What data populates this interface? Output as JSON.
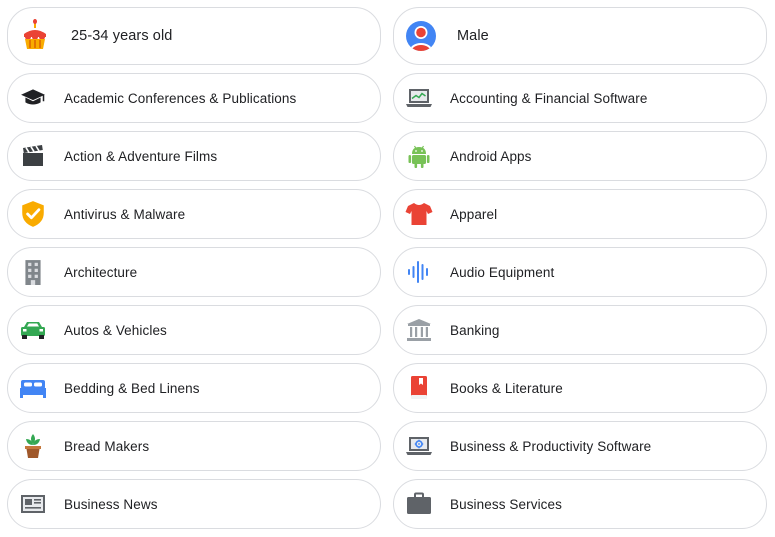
{
  "demographics": {
    "age": {
      "label": "25-34 years old",
      "icon": "birthday-cake-icon"
    },
    "gender": {
      "label": "Male",
      "icon": "user-avatar-icon"
    }
  },
  "interests": {
    "left": [
      {
        "label": "Academic Conferences & Publications",
        "icon": "graduation-cap-icon"
      },
      {
        "label": "Action & Adventure Films",
        "icon": "clapperboard-icon"
      },
      {
        "label": "Antivirus & Malware",
        "icon": "shield-check-icon"
      },
      {
        "label": "Architecture",
        "icon": "building-icon"
      },
      {
        "label": "Autos & Vehicles",
        "icon": "car-icon"
      },
      {
        "label": "Bedding & Bed Linens",
        "icon": "bed-icon"
      },
      {
        "label": "Bread Makers",
        "icon": "potted-plant-icon"
      },
      {
        "label": "Business News",
        "icon": "newspaper-icon"
      }
    ],
    "right": [
      {
        "label": "Accounting & Financial Software",
        "icon": "laptop-chart-icon"
      },
      {
        "label": "Android Apps",
        "icon": "android-icon"
      },
      {
        "label": "Apparel",
        "icon": "tshirt-icon"
      },
      {
        "label": "Audio Equipment",
        "icon": "audio-wave-icon"
      },
      {
        "label": "Banking",
        "icon": "bank-icon"
      },
      {
        "label": "Books & Literature",
        "icon": "book-icon"
      },
      {
        "label": "Business & Productivity Software",
        "icon": "laptop-gear-icon"
      },
      {
        "label": "Business Services",
        "icon": "briefcase-icon"
      }
    ]
  },
  "colors": {
    "chip_border": "#dadce0",
    "text": "#202124",
    "google_blue": "#4285f4",
    "google_red": "#ea4335",
    "google_yellow": "#f9ab00",
    "google_green": "#34a853"
  }
}
